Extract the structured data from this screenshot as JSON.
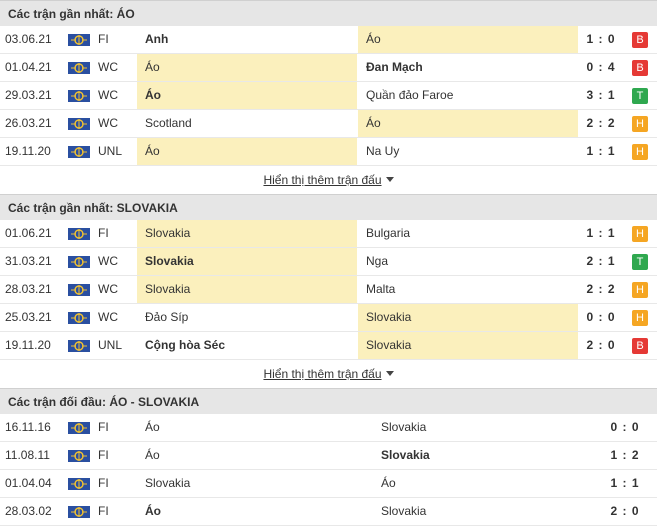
{
  "section1": {
    "title": "Các trận gần nhất: ÁO",
    "more_label": "Hiển thị thêm trận đấu",
    "rows": [
      {
        "date": "03.06.21",
        "comp": "FI",
        "home": "Anh",
        "away": "Áo",
        "score": "1 : 0",
        "result": "B",
        "home_bold": true,
        "away_bold": false,
        "hl": "away"
      },
      {
        "date": "01.04.21",
        "comp": "WC",
        "home": "Áo",
        "away": "Đan Mạch",
        "score": "0 : 4",
        "result": "B",
        "home_bold": false,
        "away_bold": true,
        "hl": "home"
      },
      {
        "date": "29.03.21",
        "comp": "WC",
        "home": "Áo",
        "away": "Quần đảo Faroe",
        "score": "3 : 1",
        "result": "T",
        "home_bold": true,
        "away_bold": false,
        "hl": "home"
      },
      {
        "date": "26.03.21",
        "comp": "WC",
        "home": "Scotland",
        "away": "Áo",
        "score": "2 : 2",
        "result": "H",
        "home_bold": false,
        "away_bold": false,
        "hl": "away"
      },
      {
        "date": "19.11.20",
        "comp": "UNL",
        "home": "Áo",
        "away": "Na Uy",
        "score": "1 : 1",
        "result": "H",
        "home_bold": false,
        "away_bold": false,
        "hl": "home"
      }
    ]
  },
  "section2": {
    "title": "Các trận gần nhất: SLOVAKIA",
    "more_label": "Hiển thị thêm trận đấu",
    "rows": [
      {
        "date": "01.06.21",
        "comp": "FI",
        "home": "Slovakia",
        "away": "Bulgaria",
        "score": "1 : 1",
        "result": "H",
        "home_bold": false,
        "away_bold": false,
        "hl": "home"
      },
      {
        "date": "31.03.21",
        "comp": "WC",
        "home": "Slovakia",
        "away": "Nga",
        "score": "2 : 1",
        "result": "T",
        "home_bold": true,
        "away_bold": false,
        "hl": "home"
      },
      {
        "date": "28.03.21",
        "comp": "WC",
        "home": "Slovakia",
        "away": "Malta",
        "score": "2 : 2",
        "result": "H",
        "home_bold": false,
        "away_bold": false,
        "hl": "home"
      },
      {
        "date": "25.03.21",
        "comp": "WC",
        "home": "Đảo Síp",
        "away": "Slovakia",
        "score": "0 : 0",
        "result": "H",
        "home_bold": false,
        "away_bold": false,
        "hl": "away"
      },
      {
        "date": "19.11.20",
        "comp": "UNL",
        "home": "Cộng hòa Séc",
        "away": "Slovakia",
        "score": "2 : 0",
        "result": "B",
        "home_bold": true,
        "away_bold": false,
        "hl": "away"
      }
    ]
  },
  "section3": {
    "title": "Các trận đối đầu: ÁO - SLOVAKIA",
    "rows": [
      {
        "date": "16.11.16",
        "comp": "FI",
        "home": "Áo",
        "away": "Slovakia",
        "score": "0 : 0",
        "home_bold": false,
        "away_bold": false
      },
      {
        "date": "11.08.11",
        "comp": "FI",
        "home": "Áo",
        "away": "Slovakia",
        "score": "1 : 2",
        "home_bold": false,
        "away_bold": true
      },
      {
        "date": "01.04.04",
        "comp": "FI",
        "home": "Slovakia",
        "away": "Áo",
        "score": "1 : 1",
        "home_bold": false,
        "away_bold": false
      },
      {
        "date": "28.03.02",
        "comp": "FI",
        "home": "Áo",
        "away": "Slovakia",
        "score": "2 : 0",
        "home_bold": true,
        "away_bold": false
      }
    ]
  },
  "colors": {
    "loss": "#e53935",
    "win": "#2fa84f",
    "draw": "#f5a623",
    "highlight": "#fbf0bd"
  },
  "icons": {
    "competition": "world-flag-icon",
    "more": "caret-down-icon"
  }
}
